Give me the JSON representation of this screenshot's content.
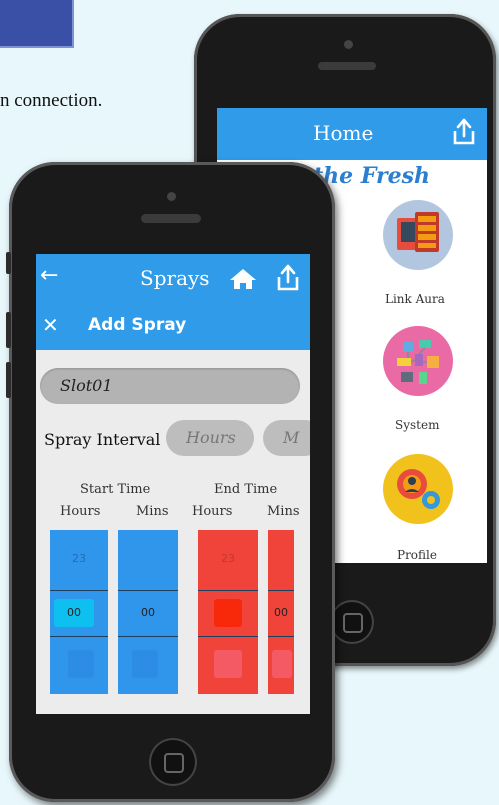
{
  "caption": "n connection.",
  "back_phone": {
    "title": "Home",
    "brand": "the Fresh",
    "menu": [
      {
        "label": "Link Aura",
        "icon": "link-aura-icon"
      },
      {
        "label": "System",
        "icon": "system-icon"
      },
      {
        "label": "Profile",
        "icon": "profile-icon"
      }
    ]
  },
  "front_phone": {
    "title": "Sprays",
    "subtitle": "Add Spray",
    "slot_value": "Slot01",
    "interval_label": "Spray Interval",
    "interval_unit_1": "Hours",
    "interval_unit_2": "M",
    "start_time_label": "Start Time",
    "end_time_label": "End Time",
    "col_hours": "Hours",
    "col_mins": "Mins",
    "start_hours_prev": "23",
    "start_hours_sel": "00",
    "start_mins_sel": "00",
    "end_hours_prev": "23",
    "end_mins_sel": "00"
  },
  "colors": {
    "header_blue": "#2f9be9",
    "picker_blue": "#2f96eb",
    "picker_red": "#f0443b"
  }
}
